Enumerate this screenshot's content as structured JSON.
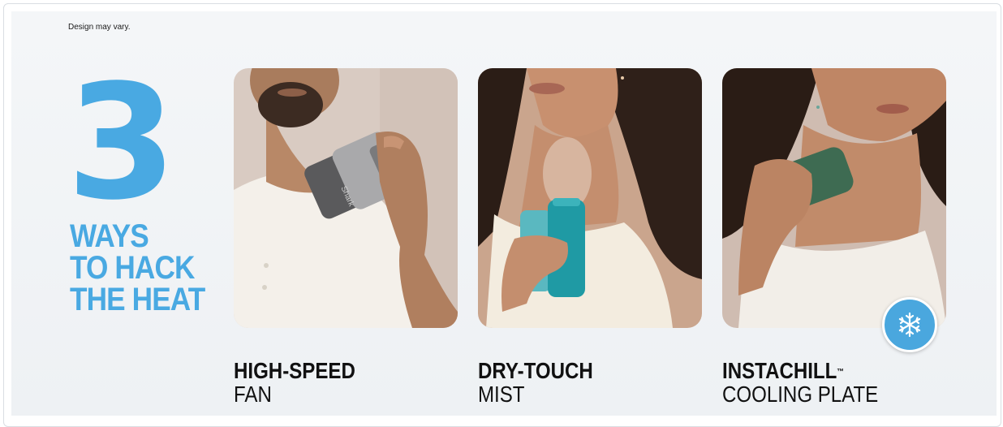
{
  "note": "Design may vary.",
  "hero": {
    "number": "3",
    "lines": [
      "WAYS",
      "TO HACK",
      "THE HEAT"
    ],
    "color": "#49a9e2"
  },
  "features": [
    {
      "title": "HIGH-SPEED",
      "subtitle": "FAN",
      "image_icon": "man-holding-fan-image"
    },
    {
      "title": "DRY-TOUCH",
      "subtitle": "MIST",
      "image_icon": "woman-misting-image"
    },
    {
      "title": "INSTACHILL",
      "trademark": "™",
      "subtitle": "COOLING PLATE",
      "image_icon": "woman-cooling-plate-image"
    }
  ],
  "badge_icon": "snowflake-icon",
  "colors": {
    "accent": "#49a9e2",
    "text": "#111111",
    "background": "#f2f4f6"
  }
}
